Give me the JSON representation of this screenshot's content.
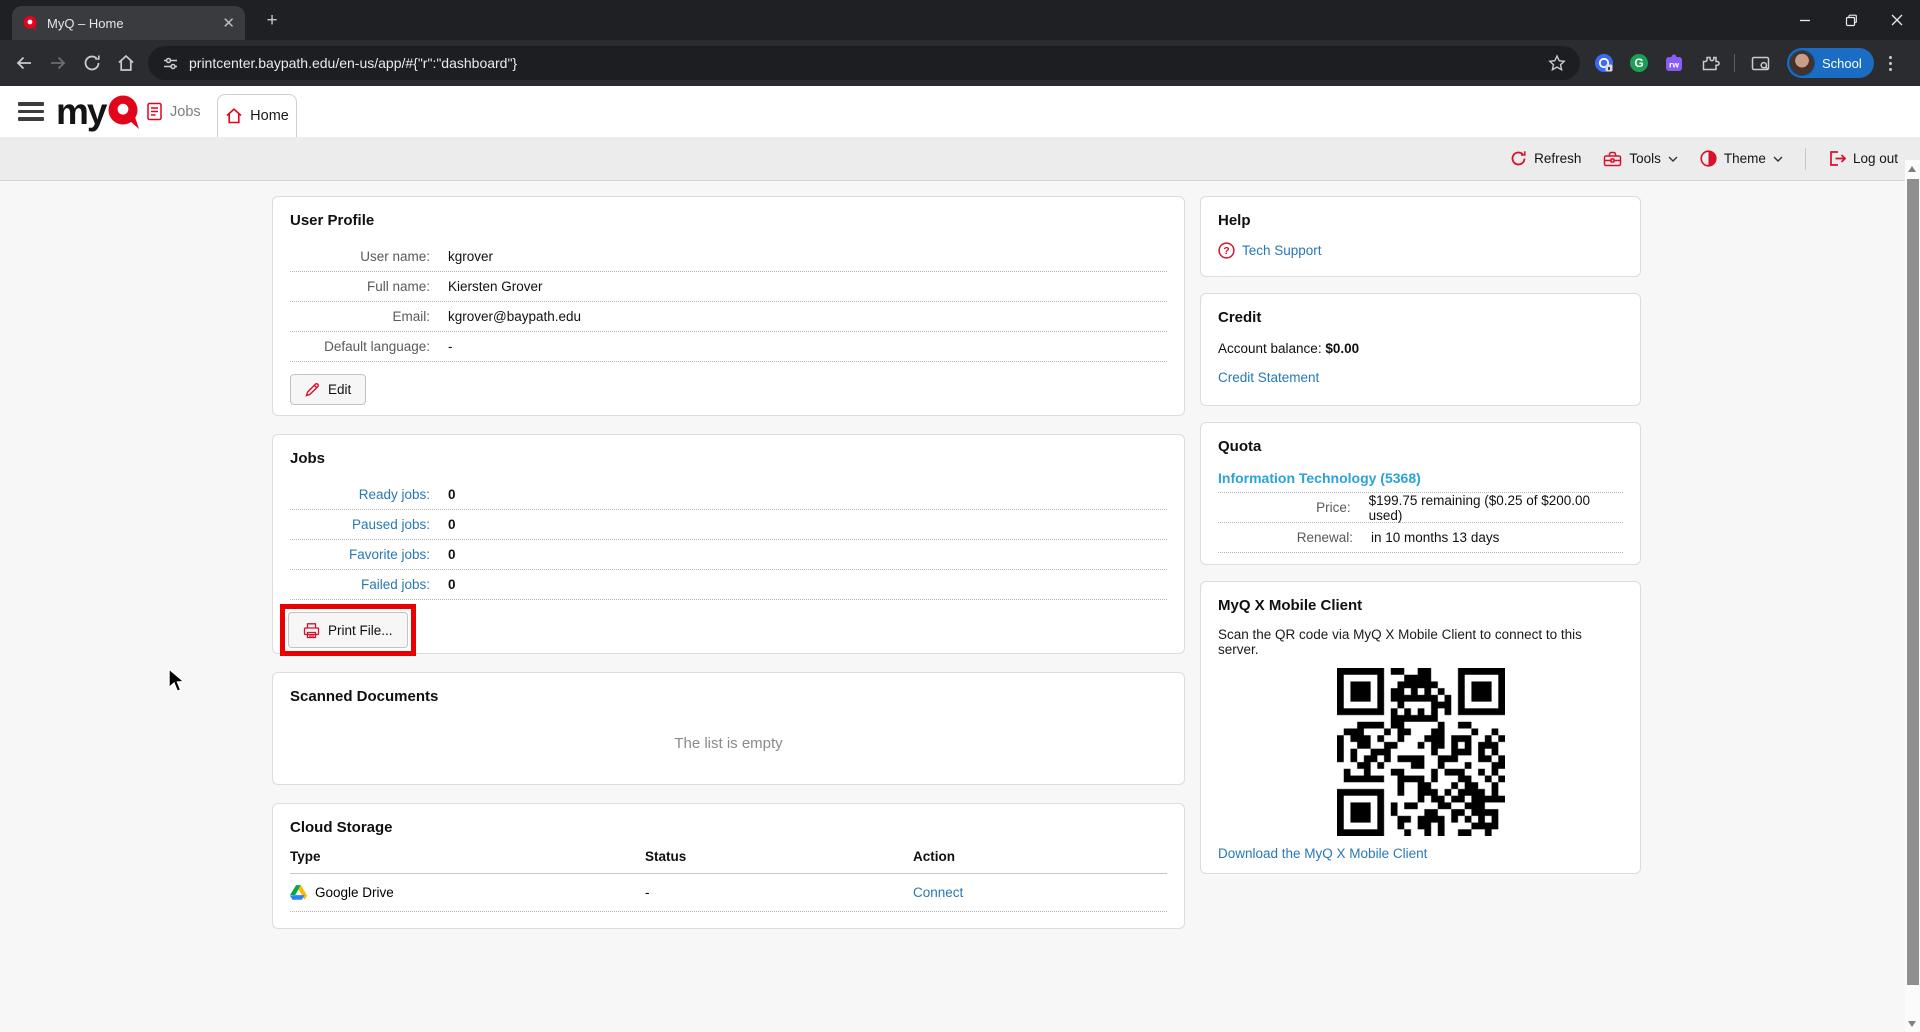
{
  "browser": {
    "tab_title": "MyQ – Home",
    "url": "printcenter.baypath.edu/en-us/app/#{\"r\":\"dashboard\"}",
    "profile_label": "School",
    "extension_rw_label": "rw",
    "extension_grammarly_label": "G"
  },
  "nav": {
    "logo_my": "my",
    "jobs_label": "Jobs",
    "home_label": "Home"
  },
  "toolbar": {
    "refresh_label": "Refresh",
    "tools_label": "Tools",
    "theme_label": "Theme",
    "logout_label": "Log out"
  },
  "user_profile": {
    "title": "User Profile",
    "rows": [
      {
        "label": "User name:",
        "value": "kgrover"
      },
      {
        "label": "Full name:",
        "value": "Kiersten Grover"
      },
      {
        "label": "Email:",
        "value": "kgrover@baypath.edu"
      },
      {
        "label": "Default language:",
        "value": "-"
      }
    ],
    "edit_button": "Edit"
  },
  "jobs": {
    "title": "Jobs",
    "rows": [
      {
        "label": "Ready jobs:",
        "value": "0"
      },
      {
        "label": "Paused jobs:",
        "value": "0"
      },
      {
        "label": "Favorite jobs:",
        "value": "0"
      },
      {
        "label": "Failed jobs:",
        "value": "0"
      }
    ],
    "print_file_button": "Print File..."
  },
  "scanned_documents": {
    "title": "Scanned Documents",
    "empty_text": "The list is empty"
  },
  "cloud_storage": {
    "title": "Cloud Storage",
    "columns": [
      "Type",
      "Status",
      "Action"
    ],
    "rows": [
      {
        "type": "Google Drive",
        "status": "-",
        "action": "Connect"
      }
    ]
  },
  "help": {
    "title": "Help",
    "link": "Tech Support"
  },
  "credit": {
    "title": "Credit",
    "balance_label": "Account balance: ",
    "balance_value": "$0.00",
    "link": "Credit Statement"
  },
  "quota": {
    "title": "Quota",
    "department_link": "Information Technology (5368)",
    "rows": [
      {
        "label": "Price:",
        "value": "$199.75 remaining ($0.25 of $200.00 used)"
      },
      {
        "label": "Renewal:",
        "value": "in 10 months 13 days"
      }
    ]
  },
  "mobile_client": {
    "title": "MyQ X Mobile Client",
    "description": "Scan the QR code via MyQ X Mobile Client to connect to this server.",
    "link": "Download the MyQ X Mobile Client"
  },
  "colors": {
    "brand_red": "#e2041b",
    "link_blue": "#2878b5",
    "quota_link_blue": "#2aa3db",
    "highlight_red": "#eb0000",
    "profile_pill_blue": "#1a6dc2"
  },
  "icons": {
    "tab_favicon": "myq-logo",
    "refresh": "circular-arrows",
    "tools": "toolbox",
    "theme": "half-filled-circle",
    "logout": "exit-arrow",
    "edit": "pencil",
    "print": "printer",
    "tech_support": "question-circle",
    "cloud_row": "google-drive-triangle"
  }
}
